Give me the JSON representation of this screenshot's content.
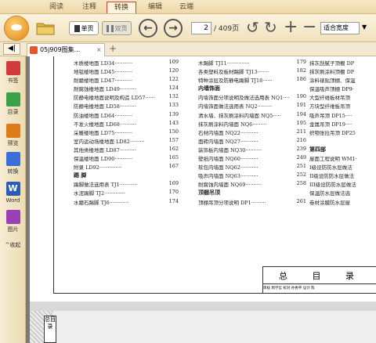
{
  "menu": {
    "items": [
      {
        "label": "阅读",
        "active": false
      },
      {
        "label": "注释",
        "active": false
      },
      {
        "label": "转换",
        "active": true
      },
      {
        "label": "编辑",
        "active": false
      },
      {
        "label": "云端",
        "active": false
      }
    ]
  },
  "toolbar": {
    "single_page_label": "单页",
    "double_page_label": "双页",
    "current_page": "2",
    "total_pages": "/ 409页",
    "zoom_value": "适合宽度"
  },
  "tabs": {
    "collapse_label": "◀|",
    "document_title": "05j909图集...",
    "close_label": "×",
    "add_label": "+"
  },
  "sidebar": {
    "items": [
      {
        "label": "书签",
        "icon": "bookmark-icon",
        "color": "#d13b3b"
      },
      {
        "label": "目录",
        "icon": "toc-icon",
        "color": "#3aa04a"
      },
      {
        "label": "预览",
        "icon": "preview-icon",
        "color": "#e07b1a"
      },
      {
        "label": "转换",
        "icon": "convert-icon",
        "color": "#3a6fd8"
      },
      {
        "label": "Word",
        "icon": "word-icon",
        "color": "#2b5bb5"
      },
      {
        "label": "图片",
        "icon": "image-icon",
        "color": "#9b3fb5"
      }
    ],
    "collapse_label": "收起"
  },
  "toc": {
    "col1": [
      {
        "text": "木质楼地面 LD34···········",
        "page": "109"
      },
      {
        "text": "地毯楼地面 LD45···········",
        "page": "120"
      },
      {
        "text": "耐磨楼地面 LD47···········",
        "page": "122"
      },
      {
        "text": "耐腐蚀楼地面 LD49··········",
        "page": "124"
      },
      {
        "text": "防静电楼地面说明及构造 LD57······",
        "page": "132"
      },
      {
        "text": "防静电楼地面 LD58··········",
        "page": "133"
      },
      {
        "text": "防油楼地面 LD64···········",
        "page": "139"
      },
      {
        "text": "不发火楼地面 LD68··········",
        "page": "143"
      },
      {
        "text": "采暖楼地面 LD75···········",
        "page": "150"
      },
      {
        "text": "室内运动场楼地面 LD82·········",
        "page": "157"
      },
      {
        "text": "其他类楼地面 LD87··········",
        "page": "162"
      },
      {
        "text": "保温楼地面 LD90···········",
        "page": "165"
      },
      {
        "text": "附录 LD92··············",
        "page": "167"
      },
      {
        "text": "踢 脚",
        "page": "",
        "heading": true
      },
      {
        "text": "踢脚做法选用表 TJ1···········",
        "page": "169"
      },
      {
        "text": "水泥踢脚 TJ2·············",
        "page": "170"
      },
      {
        "text": "水磨石踢脚 TJ6············",
        "page": "174"
      }
    ],
    "col2": [
      {
        "text": "木踢脚 TJ11··············",
        "page": "179"
      },
      {
        "text": "各类塑料及板材踢脚 TJ13·······",
        "page": "182"
      },
      {
        "text": "特种涂层及防静电踢脚 TJ18······",
        "page": "186"
      },
      {
        "text": "内墙饰面",
        "page": "",
        "heading": true
      },
      {
        "text": "内墙饰面分项说明及做法选用表 NQ1····",
        "page": "190"
      },
      {
        "text": "内墙饰面做法选用表 NQ2·········",
        "page": "191"
      },
      {
        "text": "清水墙、抹灰刷涂料内墙面 NQ5·····",
        "page": "194"
      },
      {
        "text": "抹灰刷涂料内墙面 NQ6·········",
        "page": "195"
      },
      {
        "text": "石材内墙面 NQ22···········",
        "page": "211"
      },
      {
        "text": "面砖内墙面 NQ27···········",
        "page": "216"
      },
      {
        "text": "装饰板内墙面 NQ30··········",
        "page": "239"
      },
      {
        "text": "壁纸内墙面 NQ60···········",
        "page": "249"
      },
      {
        "text": "软包内墙面 NQ62···········",
        "page": "251"
      },
      {
        "text": "吸声内墙面 NQ63···········",
        "page": "252"
      },
      {
        "text": "耐腐蚀内墙面 NQ69··········",
        "page": "258"
      },
      {
        "text": "顶棚吊顶",
        "page": "",
        "heading": true
      },
      {
        "text": "顶棚吊顶分项说明 DP1·········",
        "page": "261"
      }
    ],
    "col3": [
      {
        "text": "抹灰刮腻子顶棚 DP"
      },
      {
        "text": "抹灰刷涂料顶棚 DP"
      },
      {
        "text": "涂料裱贴顶棚、保温"
      },
      {
        "text": "保温吸声顶棚 DP9·"
      },
      {
        "text": "大型纤维板材吊顶"
      },
      {
        "text": "方块型纤维板吊顶"
      },
      {
        "text": "吸声吊顶 DP15····"
      },
      {
        "text": "金属吊顶 DP19····"
      },
      {
        "text": "织物张拉吊顶 DP25"
      },
      {
        "text": ""
      },
      {
        "text": "第四部",
        "heading": true
      },
      {
        "text": "屋面工程说明 WM1·"
      },
      {
        "text": "I级设防防水层做法"
      },
      {
        "text": "II级设防防水层做法"
      },
      {
        "text": "III级设防防水层做法"
      },
      {
        "text": "保温防水层做法选"
      },
      {
        "text": "卷材涂膜防水层屋"
      }
    ]
  },
  "title_block": {
    "title": "总 目 录",
    "row": "审核 周学信 校对 孙秀平 设计 陈"
  },
  "next_page": {
    "label": "总目录"
  }
}
